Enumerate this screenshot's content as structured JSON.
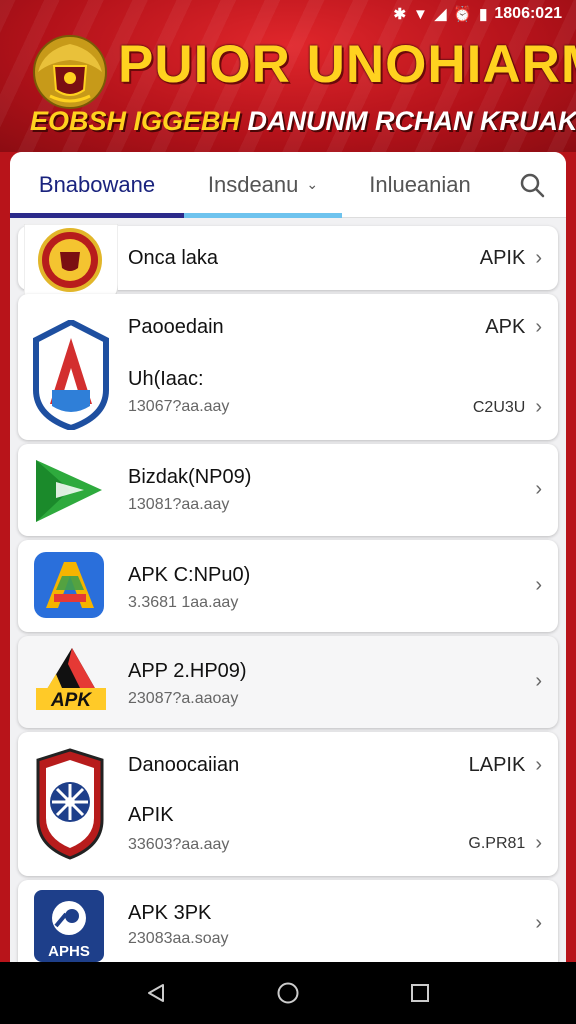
{
  "status_bar": {
    "time": "1806:021"
  },
  "banner": {
    "title": "PUIOR UNOHIARM",
    "subtitle_lead": "EOBSH IGGEBH",
    "subtitle_rest": "DANUNM RCHAN KRUAK EE APS"
  },
  "tabs": [
    {
      "label": "Bnabowane"
    },
    {
      "label": "Insdeanu"
    },
    {
      "label": "Inlueanian"
    }
  ],
  "apps": [
    {
      "name": "Onca laka",
      "right_label": "APIK"
    },
    {
      "name": "Paooedain",
      "right_label": "APK",
      "name2": "Uh(Iaac:",
      "size": "13067?aa.aay",
      "right_label2": "C2U3U"
    },
    {
      "name": "Bizdak(NP09)",
      "size": "13081?aa.aay"
    },
    {
      "name": "APK C:NPu0)",
      "size": "3.3681 1aa.aay"
    },
    {
      "name": "APP 2.HP09)",
      "size": "23087?a.aaoay"
    },
    {
      "name": "Danoocaiian",
      "right_label": "LAPIK",
      "name2": "APIK",
      "size": "33603?aa.aay",
      "right_label2": "G.PR81"
    },
    {
      "name": "APK 3PK",
      "size": "23083aa.soay",
      "icon_text": "APHS"
    }
  ],
  "icons": {
    "apk_badge_text": "APK",
    "colors": {
      "banner_red": "#b8141a",
      "title_yellow": "#ffd21f",
      "tab_active": "#2b2a8a",
      "tab_accent": "#6ec3ee"
    }
  }
}
